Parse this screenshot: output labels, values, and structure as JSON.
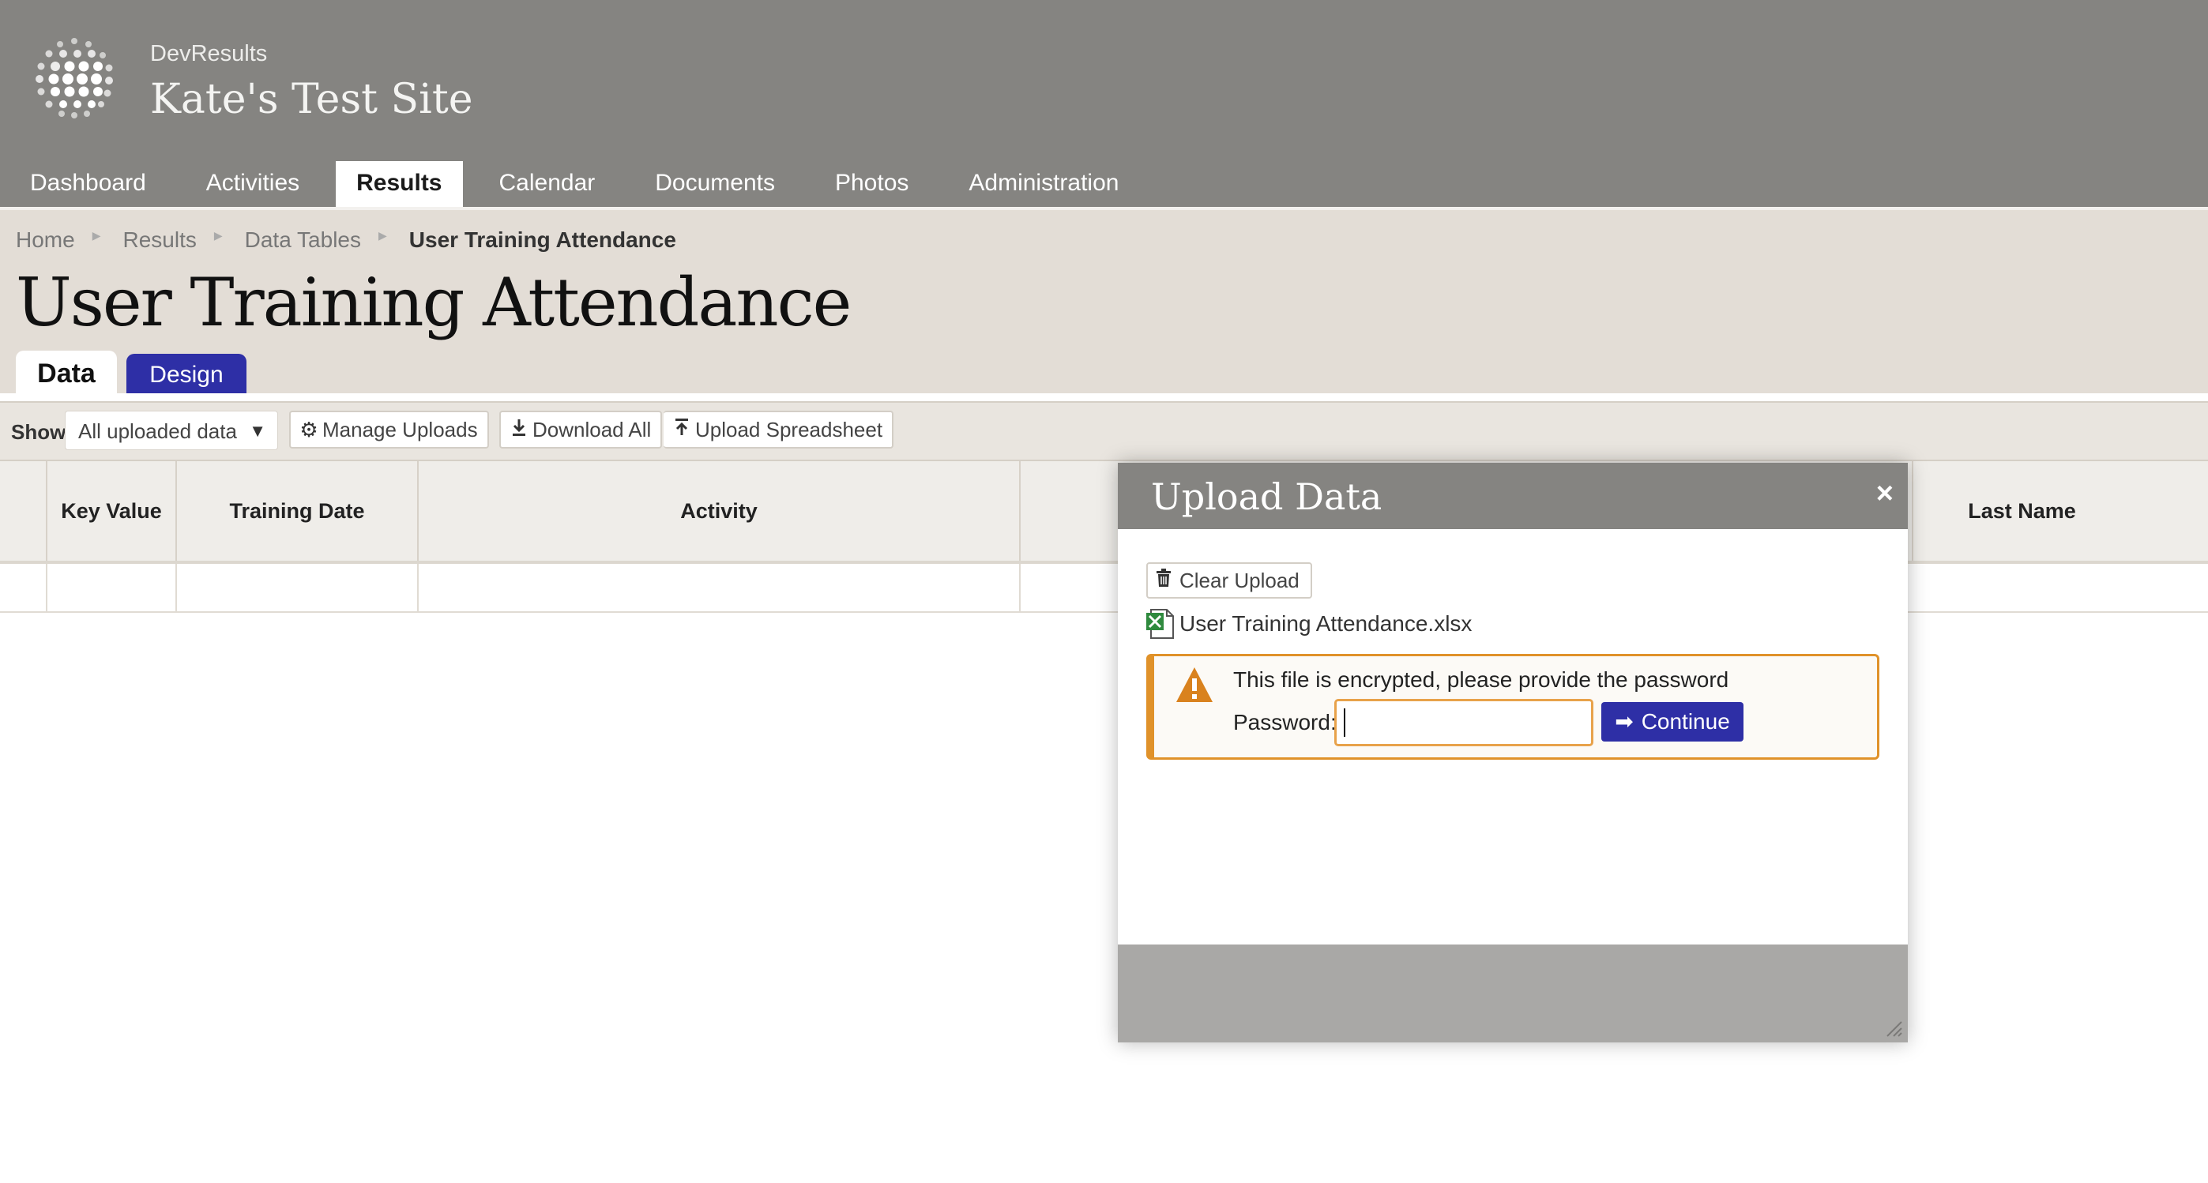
{
  "header": {
    "org": "DevResults",
    "site_title": "Kate's Test Site",
    "nav": [
      {
        "label": "Dashboard"
      },
      {
        "label": "Activities"
      },
      {
        "label": "Results",
        "active": true
      },
      {
        "label": "Calendar"
      },
      {
        "label": "Documents"
      },
      {
        "label": "Photos"
      },
      {
        "label": "Administration"
      }
    ]
  },
  "breadcrumb": [
    "Home",
    "Results",
    "Data Tables",
    "User Training Attendance"
  ],
  "page_title": "User Training Attendance",
  "tabs": {
    "data": "Data",
    "design": "Design"
  },
  "toolbar": {
    "show_label": "Show",
    "show_value": "All uploaded data",
    "manage_uploads": "Manage Uploads",
    "download_all": "Download All",
    "upload_spreadsheet": "Upload Spreadsheet"
  },
  "table": {
    "columns": [
      "Key Value",
      "Training Date",
      "Activity",
      "Last Name"
    ]
  },
  "modal": {
    "title": "Upload Data",
    "close": "×",
    "clear_upload": "Clear Upload",
    "file_name": "User Training Attendance.xlsx",
    "alert_message": "This file is encrypted, please provide the password",
    "password_label": "Password:",
    "password_value": "",
    "continue_label": "Continue"
  },
  "colors": {
    "header_bg": "#858481",
    "accent": "#2e2fa6",
    "warning": "#e0922a",
    "page_header_bg": "#e3ddd6"
  }
}
